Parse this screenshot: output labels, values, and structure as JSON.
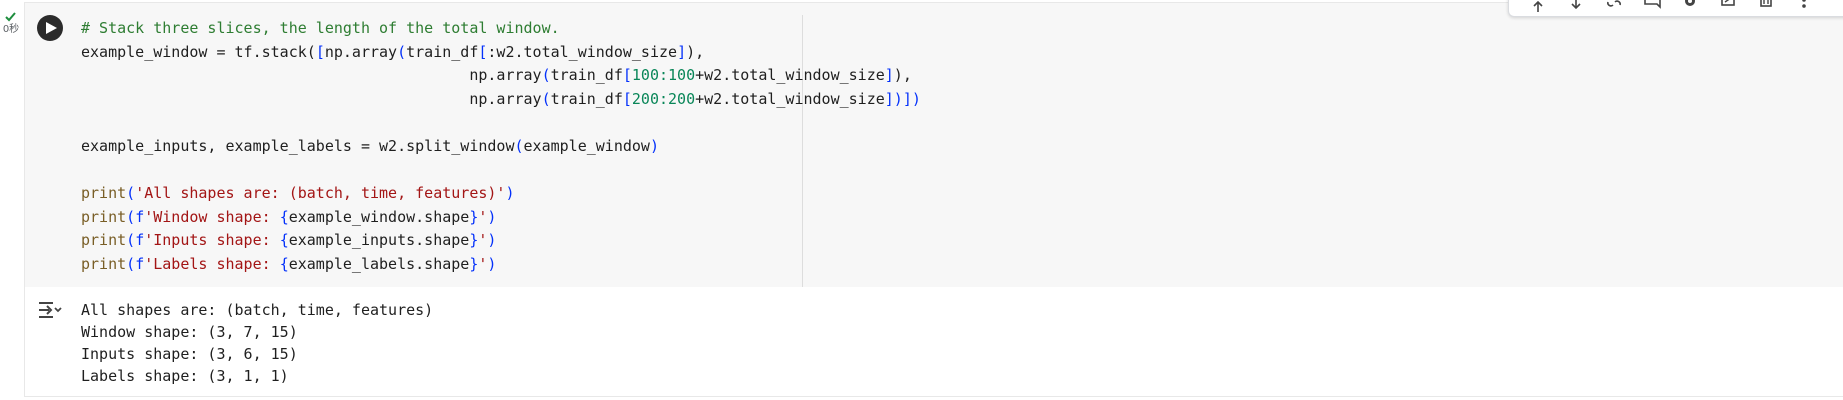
{
  "status": {
    "exec_time": "0秒",
    "success_color": "#1e8e3e"
  },
  "cell": {
    "run_icon": "play-icon",
    "code_lines": [
      [
        {
          "t": "# Stack three slices, the length of the total window.",
          "c": "comment"
        }
      ],
      [
        {
          "t": "example_window = tf.stack(",
          "c": "var"
        },
        {
          "t": "[",
          "c": "par"
        },
        {
          "t": "np.array",
          "c": "var"
        },
        {
          "t": "(",
          "c": "par"
        },
        {
          "t": "train_df",
          "c": "var"
        },
        {
          "t": "[",
          "c": "par"
        },
        {
          "t": ":w2.total_window_size",
          "c": "var"
        },
        {
          "t": "]",
          "c": "par"
        },
        {
          "t": "),",
          "c": "var"
        }
      ],
      [
        {
          "t": "                                           np.array",
          "c": "var"
        },
        {
          "t": "(",
          "c": "par"
        },
        {
          "t": "train_df",
          "c": "var"
        },
        {
          "t": "[",
          "c": "par"
        },
        {
          "t": "100:100",
          "c": "num"
        },
        {
          "t": "+w2.total_window_size",
          "c": "var"
        },
        {
          "t": "]",
          "c": "par"
        },
        {
          "t": "),",
          "c": "var"
        }
      ],
      [
        {
          "t": "                                           np.array",
          "c": "var"
        },
        {
          "t": "(",
          "c": "par"
        },
        {
          "t": "train_df",
          "c": "var"
        },
        {
          "t": "[",
          "c": "par"
        },
        {
          "t": "200:200",
          "c": "num"
        },
        {
          "t": "+w2.total_window_size",
          "c": "var"
        },
        {
          "t": "]",
          "c": "par"
        },
        {
          "t": ")])",
          "c": "par"
        }
      ],
      [],
      [
        {
          "t": "example_inputs, example_labels = w2.split_window",
          "c": "var"
        },
        {
          "t": "(",
          "c": "par"
        },
        {
          "t": "example_window",
          "c": "var"
        },
        {
          "t": ")",
          "c": "par"
        }
      ],
      [],
      [
        {
          "t": "print",
          "c": "fn"
        },
        {
          "t": "(",
          "c": "par"
        },
        {
          "t": "'All shapes are: (batch, time, features)'",
          "c": "str"
        },
        {
          "t": ")",
          "c": "par"
        }
      ],
      [
        {
          "t": "print",
          "c": "fn"
        },
        {
          "t": "(",
          "c": "par"
        },
        {
          "t": "f",
          "c": "par"
        },
        {
          "t": "'Window shape: ",
          "c": "str"
        },
        {
          "t": "{",
          "c": "par"
        },
        {
          "t": "example_window.shape",
          "c": "var"
        },
        {
          "t": "}",
          "c": "par"
        },
        {
          "t": "'",
          "c": "str"
        },
        {
          "t": ")",
          "c": "par"
        }
      ],
      [
        {
          "t": "print",
          "c": "fn"
        },
        {
          "t": "(",
          "c": "par"
        },
        {
          "t": "f",
          "c": "par"
        },
        {
          "t": "'Inputs shape: ",
          "c": "str"
        },
        {
          "t": "{",
          "c": "par"
        },
        {
          "t": "example_inputs.shape",
          "c": "var"
        },
        {
          "t": "}",
          "c": "par"
        },
        {
          "t": "'",
          "c": "str"
        },
        {
          "t": ")",
          "c": "par"
        }
      ],
      [
        {
          "t": "print",
          "c": "fn"
        },
        {
          "t": "(",
          "c": "par"
        },
        {
          "t": "f",
          "c": "par"
        },
        {
          "t": "'Labels shape: ",
          "c": "str"
        },
        {
          "t": "{",
          "c": "par"
        },
        {
          "t": "example_labels.shape",
          "c": "var"
        },
        {
          "t": "}",
          "c": "par"
        },
        {
          "t": "'",
          "c": "str"
        },
        {
          "t": ")",
          "c": "par"
        }
      ]
    ]
  },
  "output": {
    "toggle_icon": "output-collapse-icon",
    "lines": [
      "All shapes are: (batch, time, features)",
      "Window shape: (3, 7, 15)",
      "Inputs shape: (3, 6, 15)",
      "Labels shape: (3, 1, 1)"
    ]
  },
  "toolbar": {
    "icons": [
      "move-up-icon",
      "move-down-icon",
      "link-icon",
      "comment-icon",
      "settings-icon",
      "mirror-icon",
      "delete-icon",
      "more-icon"
    ]
  }
}
